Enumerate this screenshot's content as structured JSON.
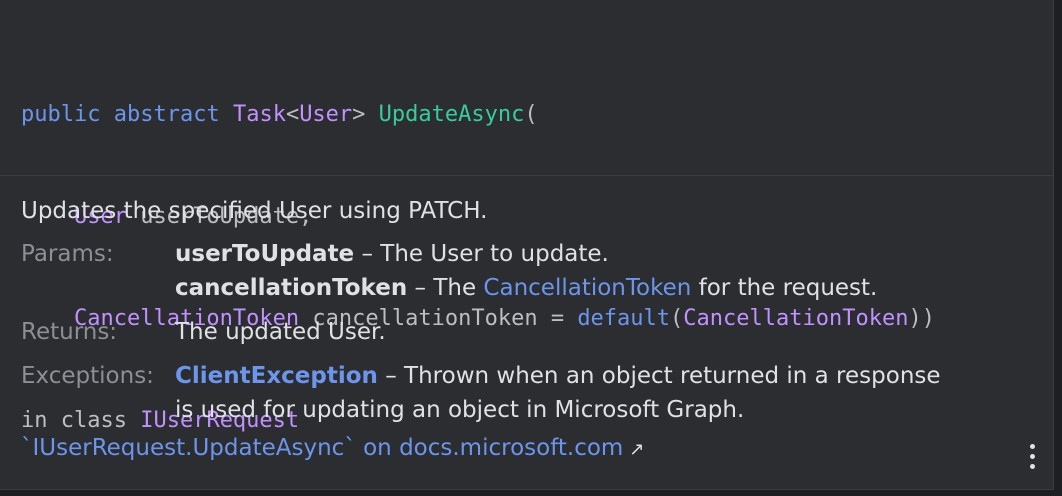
{
  "signature": {
    "line1": {
      "kw_public": "public",
      "kw_abstract": "abstract",
      "type_task": "Task",
      "lt": "<",
      "type_user": "User",
      "gt": ">",
      "method": "UpdateAsync",
      "open_paren": "("
    },
    "line2": {
      "indent": "    ",
      "type": "User",
      "name": " userToUpdate,"
    },
    "line3": {
      "indent": "    ",
      "type": "CancellationToken",
      "name": " cancellationToken = ",
      "kw_default": "default",
      "paren_open": "(",
      "type_arg": "CancellationToken",
      "paren_close": "))"
    },
    "line4": {
      "prefix": "in class ",
      "class_name": "IUserRequest"
    }
  },
  "doc": {
    "description": "Updates the specified User using PATCH.",
    "params_label": "Params:",
    "params": [
      {
        "name": "userToUpdate",
        "sep": " – ",
        "text": "The User to update."
      },
      {
        "name": "cancellationToken",
        "sep": " – ",
        "text_before": "The ",
        "link": "CancellationToken",
        "text_after": " for the request."
      }
    ],
    "returns_label": "Returns:",
    "returns_text": "The updated User.",
    "exceptions_label": "Exceptions:",
    "exception_name": "ClientException",
    "exception_line1": " – Thrown when an object returned in a response",
    "exception_line2": "is used for updating an object in Microsoft Graph."
  },
  "footer": {
    "link_text": "`IUserRequest.UpdateAsync` on docs.microsoft.com",
    "arrow": "↗"
  },
  "colors": {
    "background": "#2b2d30",
    "keyword": "#6c95eb",
    "type": "#c191ff",
    "method": "#39cc9b",
    "text": "#dfe1e5",
    "label": "#8c8f95"
  },
  "icons": {
    "external_link": "arrow-up-right-icon",
    "more": "kebab-menu-icon"
  }
}
